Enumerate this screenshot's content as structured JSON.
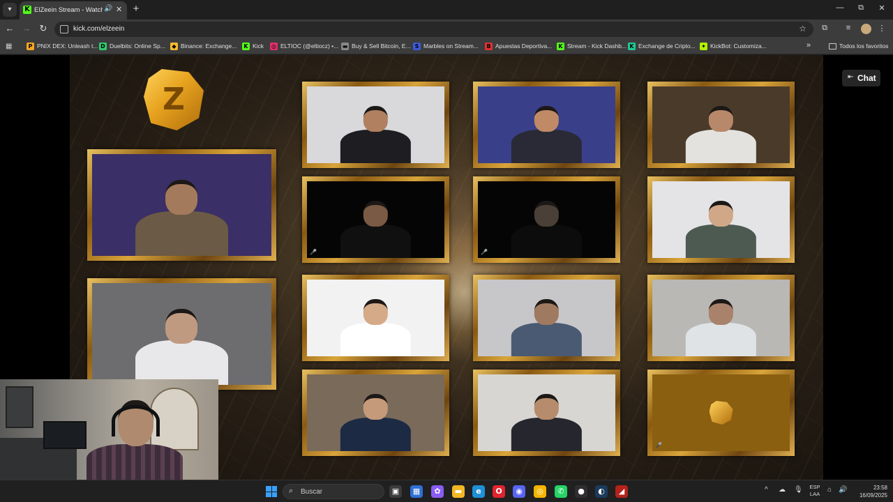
{
  "browser": {
    "tab": {
      "title": "ElZeein Stream - Watch Live",
      "favicon": "kick-icon",
      "audio_icon": "🔊",
      "close_icon": "✕"
    },
    "new_tab_icon": "+",
    "window_controls": {
      "minimize": "—",
      "restore": "⧉",
      "close": "✕"
    },
    "nav": {
      "back": "←",
      "forward": "→",
      "reload": "↻"
    },
    "url": "kick.com/elzeein",
    "bookmarks": [
      {
        "label": "PNIX DEX: Unleash t...",
        "icon": "P",
        "color": "#f5a623"
      },
      {
        "label": "Duelbits: Online Sp...",
        "icon": "D",
        "color": "#2ecc71"
      },
      {
        "label": "Binance: Exchange...",
        "icon": "◆",
        "color": "#f3ba2f"
      },
      {
        "label": "Kick",
        "icon": "K",
        "color": "#53fc18"
      },
      {
        "label": "ELTIOC (@eltiocz) •...",
        "icon": "◎",
        "color": "#e1306c"
      },
      {
        "label": "Buy & Sell Bitcoin, E...",
        "icon": "▬",
        "color": "#888888"
      },
      {
        "label": "Marbles on Stream...",
        "icon": "S",
        "color": "#3b5bdb"
      },
      {
        "label": "Apuestas Deportiva...",
        "icon": "B",
        "color": "#e03131"
      },
      {
        "label": "Stream - Kick Dashb...",
        "icon": "K",
        "color": "#53fc18"
      },
      {
        "label": "Exchange de Cripto...",
        "icon": "K",
        "color": "#20c997"
      },
      {
        "label": "KickBot: Customiza...",
        "icon": "✦",
        "color": "#b2f200"
      }
    ],
    "bookmarks_more": "»",
    "all_bookmarks": "Todos los favoritos"
  },
  "stream": {
    "chat_button": "Chat",
    "logo_letter": "Z",
    "tiles": [
      {
        "id": "host",
        "bg": "#3a2f66",
        "skin": "#a47a5c",
        "shirt": "#6b5a45"
      },
      {
        "id": "p1",
        "bg": "#d9d9dc",
        "skin": "#b08060",
        "shirt": "#1e1e22"
      },
      {
        "id": "p2",
        "bg": "#3a3f8a",
        "skin": "#c08a66",
        "shirt": "#2a2a36"
      },
      {
        "id": "p3",
        "bg": "#4a3a2a",
        "skin": "#b8886a",
        "shirt": "#e4e2de"
      },
      {
        "id": "p4",
        "bg": "#050505",
        "skin": "#7a5a44",
        "shirt": "#101010"
      },
      {
        "id": "p5",
        "bg": "#050505",
        "skin": "#4a4038",
        "shirt": "#0c0c0c"
      },
      {
        "id": "p6",
        "bg": "#e4e4e6",
        "skin": "#d0a888",
        "shirt": "#4c5a52"
      },
      {
        "id": "p7",
        "bg": "#f2f2f2",
        "skin": "#d4aa88",
        "shirt": "#ffffff"
      },
      {
        "id": "p8",
        "bg": "#c7c7c9",
        "skin": "#a07a60",
        "shirt": "#4a5a72"
      },
      {
        "id": "p9",
        "bg": "#b9b8b4",
        "skin": "#a8826a",
        "shirt": "#dfe3e6"
      },
      {
        "id": "p10",
        "bg": "#6d6d70",
        "skin": "#c09a80",
        "shirt": "#e8e8ea"
      },
      {
        "id": "p11",
        "bg": "#7a6a5a",
        "skin": "#c49a7a",
        "shirt": "#1c2a44"
      },
      {
        "id": "p12",
        "bg": "#d8d6d2",
        "skin": "#b68c6c",
        "shirt": "#26262e"
      },
      {
        "id": "empty",
        "bg": "#8a5f10",
        "skin": "",
        "shirt": ""
      }
    ]
  },
  "taskbar": {
    "search_placeholder": "Buscar",
    "apps": [
      {
        "name": "task-view",
        "glyph": "▣",
        "color": "#3b3b3b"
      },
      {
        "name": "store",
        "glyph": "▦",
        "color": "#2f6fd6"
      },
      {
        "name": "copilot",
        "glyph": "✿",
        "color": "#8a5cf6"
      },
      {
        "name": "explorer",
        "glyph": "▬",
        "color": "#f2b824"
      },
      {
        "name": "edge",
        "glyph": "e",
        "color": "#1e90d6"
      },
      {
        "name": "opera",
        "glyph": "O",
        "color": "#e0242f"
      },
      {
        "name": "discord",
        "glyph": "◉",
        "color": "#5865f2"
      },
      {
        "name": "chrome",
        "glyph": "◎",
        "color": "#f4b400"
      },
      {
        "name": "whatsapp",
        "glyph": "✆",
        "color": "#25d366"
      },
      {
        "name": "obs",
        "glyph": "●",
        "color": "#302e31"
      },
      {
        "name": "steam",
        "glyph": "◐",
        "color": "#1b3a5c"
      },
      {
        "name": "dota",
        "glyph": "◢",
        "color": "#b3231c"
      }
    ],
    "tray_chevron": "^",
    "language": "ESP",
    "language_sub": "LAA",
    "time": "23:58",
    "date": "16/09/2025"
  }
}
